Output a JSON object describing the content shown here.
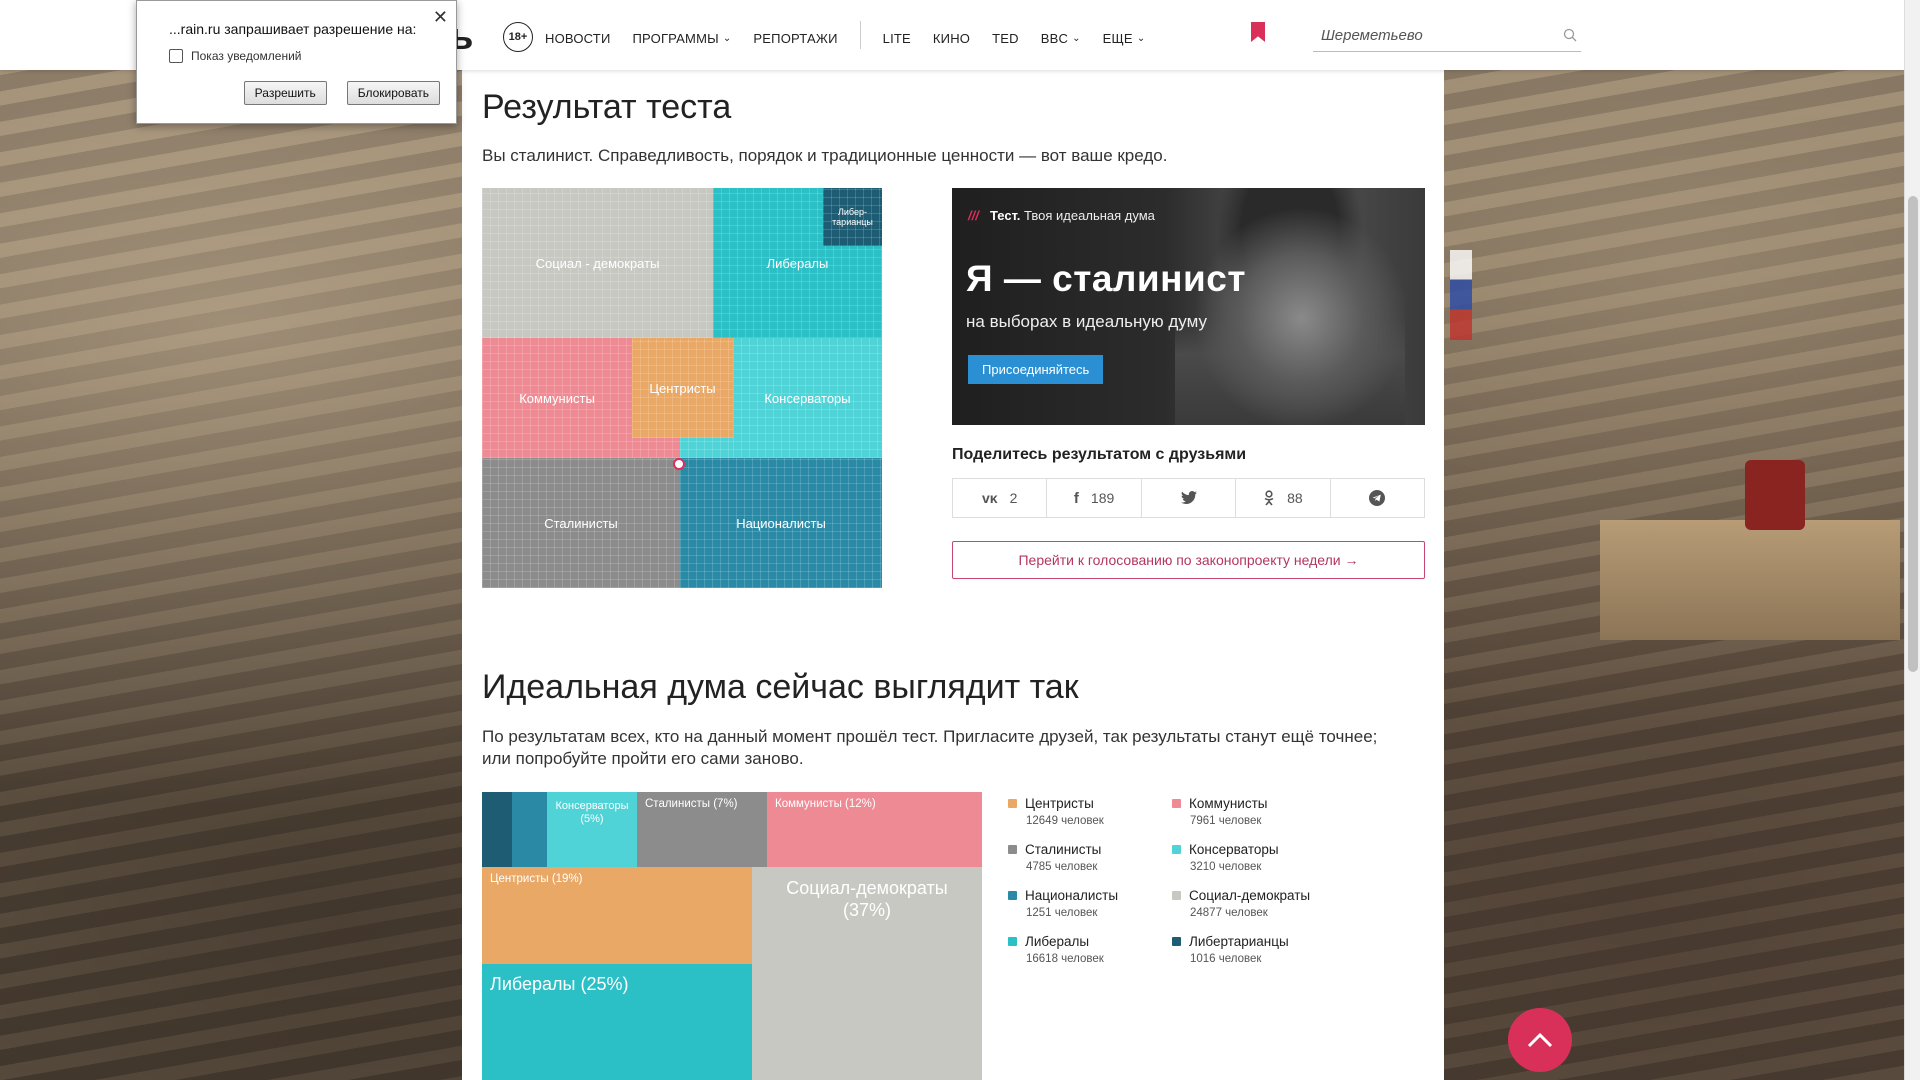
{
  "permission_popup": {
    "title": "...rain.ru запрашивает разрешение на:",
    "item": "Показ уведомлений",
    "allow": "Разрешить",
    "block": "Блокировать",
    "close": "✕"
  },
  "header": {
    "logo_fragment": "ь",
    "age": "18+",
    "nav": [
      {
        "label": "НОВОСТИ",
        "dropdown": false
      },
      {
        "label": "ПРОГРАММЫ",
        "dropdown": true
      },
      {
        "label": "РЕПОРТАЖИ",
        "dropdown": false
      }
    ],
    "nav2": [
      {
        "label": "LITE",
        "dropdown": false
      },
      {
        "label": "КИНО",
        "dropdown": false
      },
      {
        "label": "TED",
        "dropdown": false
      },
      {
        "label": "BBC",
        "dropdown": true
      },
      {
        "label": "ЕЩЕ",
        "dropdown": true
      }
    ],
    "search_value": "Шереметьево"
  },
  "result": {
    "title": "Результат теста",
    "lead": "Вы сталинист. Справедливость, порядок и традиционные ценности — вот ваше кредо.",
    "treemap_labels": {
      "socdem": "Социал - демократы",
      "liberals": "Либералы",
      "libertarians": "Либер-\nтарианцы",
      "communists": "Коммунисты",
      "centrists": "Центристы",
      "conservatives": "Консерваторы",
      "stalinists": "Сталинисты",
      "nationalists": "Националисты"
    }
  },
  "promo": {
    "stripes": "///",
    "tag_bold": "Тест.",
    "tag_rest": " Твоя идеальная дума",
    "big": "Я — сталинист",
    "sub": "на выборах в идеальную думу",
    "join": "Присоединяйтесь"
  },
  "share": {
    "title": "Поделитесь результатом с друзьями",
    "buttons": [
      {
        "icon": "vk-icon",
        "glyph": "vk",
        "count": "2"
      },
      {
        "icon": "facebook-icon",
        "glyph": "f",
        "count": "189"
      },
      {
        "icon": "twitter-icon",
        "glyph": "🐦",
        "count": ""
      },
      {
        "icon": "odnoklassniki-icon",
        "glyph": "ok",
        "count": "88"
      },
      {
        "icon": "telegram-icon",
        "glyph": "➤",
        "count": ""
      }
    ]
  },
  "vote_link": "Перейти к голосованию по законопроекту недели →",
  "overall": {
    "title": "Идеальная дума сейчас выглядит так",
    "lead": "По результатам всех, кто на данный момент прошёл тест. Пригласите друзей, так результаты станут ещё точнее; или попробуйте пройти его сами заново.",
    "cells": {
      "conservatives": "Консерваторы\n(5%)",
      "stalinists": "Сталинисты (7%)",
      "communists": "Коммунисты (12%)",
      "centrists": "Центристы (19%)",
      "socdem": "Социал-демократы\n(37%)",
      "liberals": "Либералы (25%)"
    }
  },
  "chart_data": {
    "type": "table",
    "columns": [
      "party",
      "people"
    ],
    "rows": [
      [
        "Центристы",
        12649
      ],
      [
        "Коммунисты",
        7961
      ],
      [
        "Сталинисты",
        4785
      ],
      [
        "Консерваторы",
        3210
      ],
      [
        "Националисты",
        1251
      ],
      [
        "Социал-демократы",
        24877
      ],
      [
        "Либералы",
        16618
      ],
      [
        "Либертарианцы",
        1016
      ]
    ],
    "unit": "человек",
    "share_pct": {
      "Консерваторы": 5,
      "Сталинисты": 7,
      "Коммунисты": 12,
      "Центристы": 19,
      "Социал-демократы": 37,
      "Либералы": 25
    }
  },
  "legend": [
    {
      "name": "Центристы",
      "count": "12649 человек",
      "color": "#e9a865"
    },
    {
      "name": "Коммунисты",
      "count": "7961 человек",
      "color": "#ee8a93"
    },
    {
      "name": "Сталинисты",
      "count": "4785 человек",
      "color": "#8c8c8c"
    },
    {
      "name": "Консерваторы",
      "count": "3210 человек",
      "color": "#4fd3d6"
    },
    {
      "name": "Националисты",
      "count": "1251 человек",
      "color": "#2a8aa6"
    },
    {
      "name": "Социал-демократы",
      "count": "24877 человек",
      "color": "#c8c8c2"
    },
    {
      "name": "Либералы",
      "count": "16618 человек",
      "color": "#2bbfc6"
    },
    {
      "name": "Либертарианцы",
      "count": "1016 человек",
      "color": "#1d5c72"
    }
  ],
  "colors": {
    "accent": "#d9305a",
    "centrists": "#e9a865",
    "communists": "#ee8a93",
    "stalinists": "#8c8c8c",
    "conservatives": "#4fd3d6",
    "nationalists": "#2a8aa6",
    "socdem": "#c8c8c2",
    "liberals": "#2bbfc6",
    "libertarians": "#1d5c72"
  }
}
